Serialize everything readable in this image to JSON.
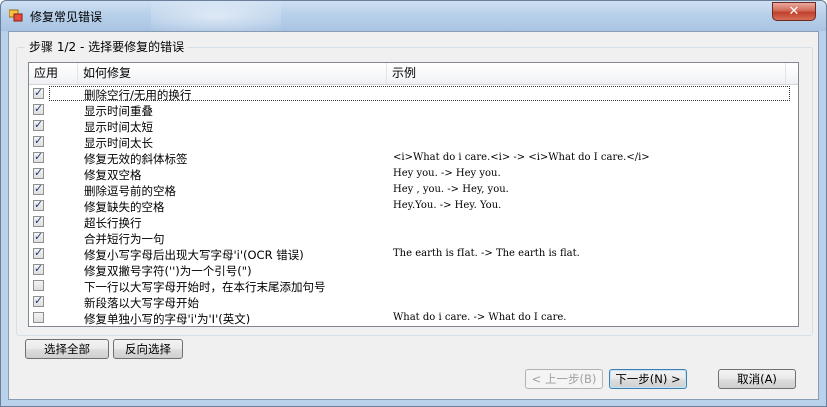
{
  "window": {
    "title": "修复常见错误",
    "close_label": "✕"
  },
  "group": {
    "title": "步骤 1/2 - 选择要修复的错误"
  },
  "list": {
    "columns": [
      "应用",
      "如何修复",
      "示例"
    ],
    "rows": [
      {
        "checked": true,
        "fix": "删除空行/无用的换行",
        "example": ""
      },
      {
        "checked": true,
        "fix": "显示时间重叠",
        "example": ""
      },
      {
        "checked": true,
        "fix": "显示时间太短",
        "example": ""
      },
      {
        "checked": true,
        "fix": "显示时间太长",
        "example": ""
      },
      {
        "checked": true,
        "fix": "修复无效的斜体标签",
        "example": "<i>What do i care.<i> -> <i>What do I care.</i>"
      },
      {
        "checked": true,
        "fix": "修复双空格",
        "example": "Hey   you. -> Hey you."
      },
      {
        "checked": true,
        "fix": "删除逗号前的空格",
        "example": "Hey , you. -> Hey, you."
      },
      {
        "checked": true,
        "fix": "修复缺失的空格",
        "example": "Hey.You. -> Hey. You."
      },
      {
        "checked": true,
        "fix": "超长行换行",
        "example": ""
      },
      {
        "checked": true,
        "fix": "合并短行为一句",
        "example": ""
      },
      {
        "checked": true,
        "fix": "修复小写字母后出现大写字母'i'(OCR 错误)",
        "example": "The earth is fIat. -> The earth is flat."
      },
      {
        "checked": true,
        "fix": "修复双撇号字符('')为一个引号(\")",
        "example": ""
      },
      {
        "checked": false,
        "fix": "下一行以大写字母开始时，在本行末尾添加句号",
        "example": ""
      },
      {
        "checked": true,
        "fix": "新段落以大写字母开始",
        "example": ""
      },
      {
        "checked": false,
        "fix": "修复单独小写的字母'i'为'I'(英文)",
        "example": "What do i care. -> What do I care."
      }
    ]
  },
  "buttons": {
    "select_all": "选择全部",
    "invert_selection": "反向选择",
    "back": "< 上一步(B)",
    "next": "下一步(N) >",
    "cancel": "取消(A)"
  }
}
